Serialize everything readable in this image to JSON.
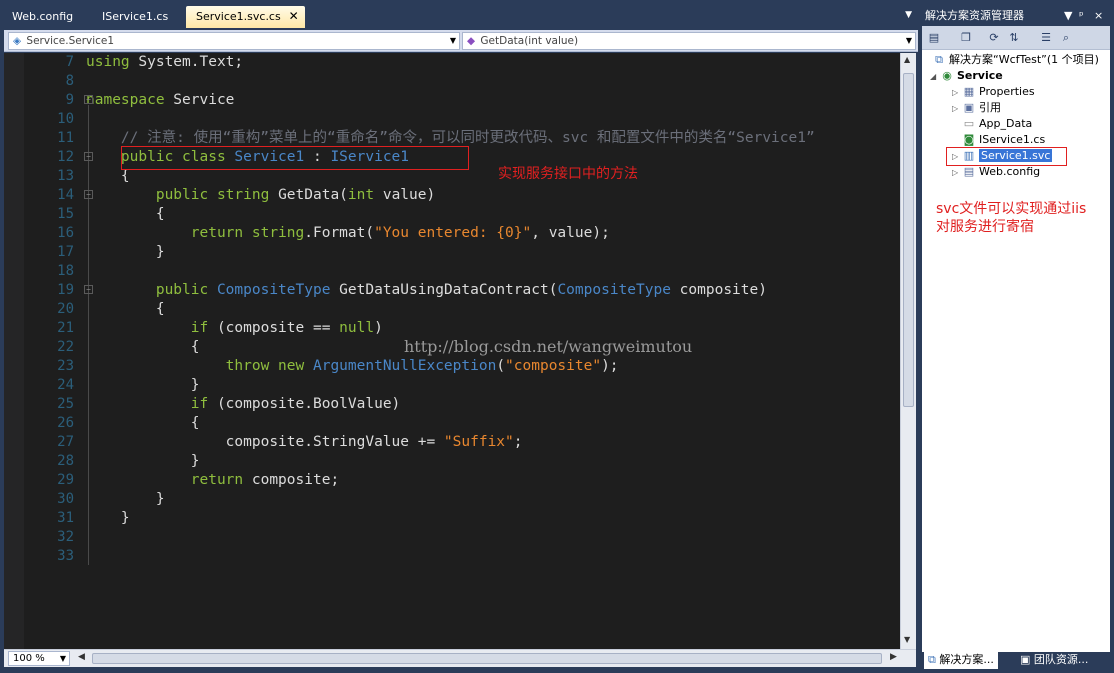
{
  "doc_tabs": [
    {
      "label": "Web.config",
      "active": false
    },
    {
      "label": "IService1.cs",
      "active": false
    },
    {
      "label": "Service1.svc.cs",
      "active": true
    }
  ],
  "nav": {
    "type_combo": "Service.Service1",
    "member_combo": "GetData(int value)"
  },
  "code_lines": [
    {
      "num": "7",
      "tokens": [
        [
          "kw",
          "using"
        ],
        [
          "pl",
          " System.Text;"
        ]
      ]
    },
    {
      "num": "8",
      "tokens": []
    },
    {
      "num": "9",
      "tokens": [
        [
          "kw",
          "namespace"
        ],
        [
          "pl",
          " Service"
        ]
      ]
    },
    {
      "num": "10",
      "tokens": []
    },
    {
      "num": "11",
      "tokens": [
        [
          "cm",
          "    // 注意: 使用“重构”菜单上的“重命名”命令，可以同时更改代码、svc 和配置文件中的类名“Service1”"
        ]
      ]
    },
    {
      "num": "12",
      "tokens": [
        [
          "kw",
          "    public class "
        ],
        [
          "ty",
          "Service1"
        ],
        [
          "pl",
          " : "
        ],
        [
          "ty",
          "IService1"
        ]
      ]
    },
    {
      "num": "13",
      "tokens": [
        [
          "pl",
          "    {"
        ]
      ]
    },
    {
      "num": "14",
      "tokens": [
        [
          "kw",
          "        public string "
        ],
        [
          "pl",
          "GetData("
        ],
        [
          "kw",
          "int"
        ],
        [
          "pl",
          " value)"
        ]
      ]
    },
    {
      "num": "15",
      "tokens": [
        [
          "pl",
          "        {"
        ]
      ]
    },
    {
      "num": "16",
      "tokens": [
        [
          "kw",
          "            return string"
        ],
        [
          "pl",
          ".Format("
        ],
        [
          "st",
          "\"You entered: {0}\""
        ],
        [
          "pl",
          ", value);"
        ]
      ]
    },
    {
      "num": "17",
      "tokens": [
        [
          "pl",
          "        }"
        ]
      ]
    },
    {
      "num": "18",
      "tokens": []
    },
    {
      "num": "19",
      "tokens": [
        [
          "kw",
          "        public "
        ],
        [
          "ty",
          "CompositeType"
        ],
        [
          "pl",
          " GetDataUsingDataContract("
        ],
        [
          "ty",
          "CompositeType"
        ],
        [
          "pl",
          " composite)"
        ]
      ]
    },
    {
      "num": "20",
      "tokens": [
        [
          "pl",
          "        {"
        ]
      ]
    },
    {
      "num": "21",
      "tokens": [
        [
          "kw",
          "            if"
        ],
        [
          "pl",
          " (composite == "
        ],
        [
          "kw",
          "null"
        ],
        [
          "pl",
          ")"
        ]
      ]
    },
    {
      "num": "22",
      "tokens": [
        [
          "pl",
          "            {"
        ]
      ]
    },
    {
      "num": "23",
      "tokens": [
        [
          "kw",
          "                throw new "
        ],
        [
          "ty",
          "ArgumentNullException"
        ],
        [
          "pl",
          "("
        ],
        [
          "st",
          "\"composite\""
        ],
        [
          "pl",
          ");"
        ]
      ]
    },
    {
      "num": "24",
      "tokens": [
        [
          "pl",
          "            }"
        ]
      ]
    },
    {
      "num": "25",
      "tokens": [
        [
          "kw",
          "            if"
        ],
        [
          "pl",
          " (composite.BoolValue)"
        ]
      ]
    },
    {
      "num": "26",
      "tokens": [
        [
          "pl",
          "            {"
        ]
      ]
    },
    {
      "num": "27",
      "tokens": [
        [
          "pl",
          "                composite.StringValue += "
        ],
        [
          "st",
          "\"Suffix\""
        ],
        [
          "pl",
          ";"
        ]
      ]
    },
    {
      "num": "28",
      "tokens": [
        [
          "pl",
          "            }"
        ]
      ]
    },
    {
      "num": "29",
      "tokens": [
        [
          "kw",
          "            return"
        ],
        [
          "pl",
          " composite;"
        ]
      ]
    },
    {
      "num": "30",
      "tokens": [
        [
          "pl",
          "        }"
        ]
      ]
    },
    {
      "num": "31",
      "tokens": [
        [
          "pl",
          "    }"
        ]
      ]
    },
    {
      "num": "32",
      "tokens": []
    },
    {
      "num": "33",
      "tokens": []
    }
  ],
  "annotations": {
    "class_note": "实现服务接口中的方法",
    "svc_note_line1": "svc文件可以实现通过iis",
    "svc_note_line2": "对服务进行寄宿",
    "watermark": "http://blog.csdn.net/wangweimutou"
  },
  "zoom": "100 %",
  "solution_explorer": {
    "title": "解决方案资源管理器",
    "title_controls": [
      "▼",
      "ᵖ",
      "×"
    ],
    "solution_label": "解决方案“WcfTest”(1 个项目)",
    "project_label": "Service",
    "items": [
      {
        "label": "Properties",
        "icon": "properties-icon",
        "expandable": true
      },
      {
        "label": "引用",
        "icon": "references-icon",
        "expandable": true
      },
      {
        "label": "App_Data",
        "icon": "folder-icon",
        "expandable": false
      },
      {
        "label": "IService1.cs",
        "icon": "cs-file-icon",
        "expandable": false
      },
      {
        "label": "Service1.svc",
        "icon": "svc-file-icon",
        "expandable": true,
        "selected": true
      },
      {
        "label": "Web.config",
        "icon": "config-file-icon",
        "expandable": true
      }
    ],
    "bottom_tabs": [
      {
        "label": "解决方案...",
        "active": true
      },
      {
        "label": "团队资源...",
        "active": false
      }
    ]
  },
  "colors": {
    "chrome": "#2b3c59",
    "editor_bg": "#1e1e1e",
    "keyword": "#8fbe3e",
    "type": "#4a87c8",
    "string": "#e8872f",
    "annotation": "#e02020"
  }
}
